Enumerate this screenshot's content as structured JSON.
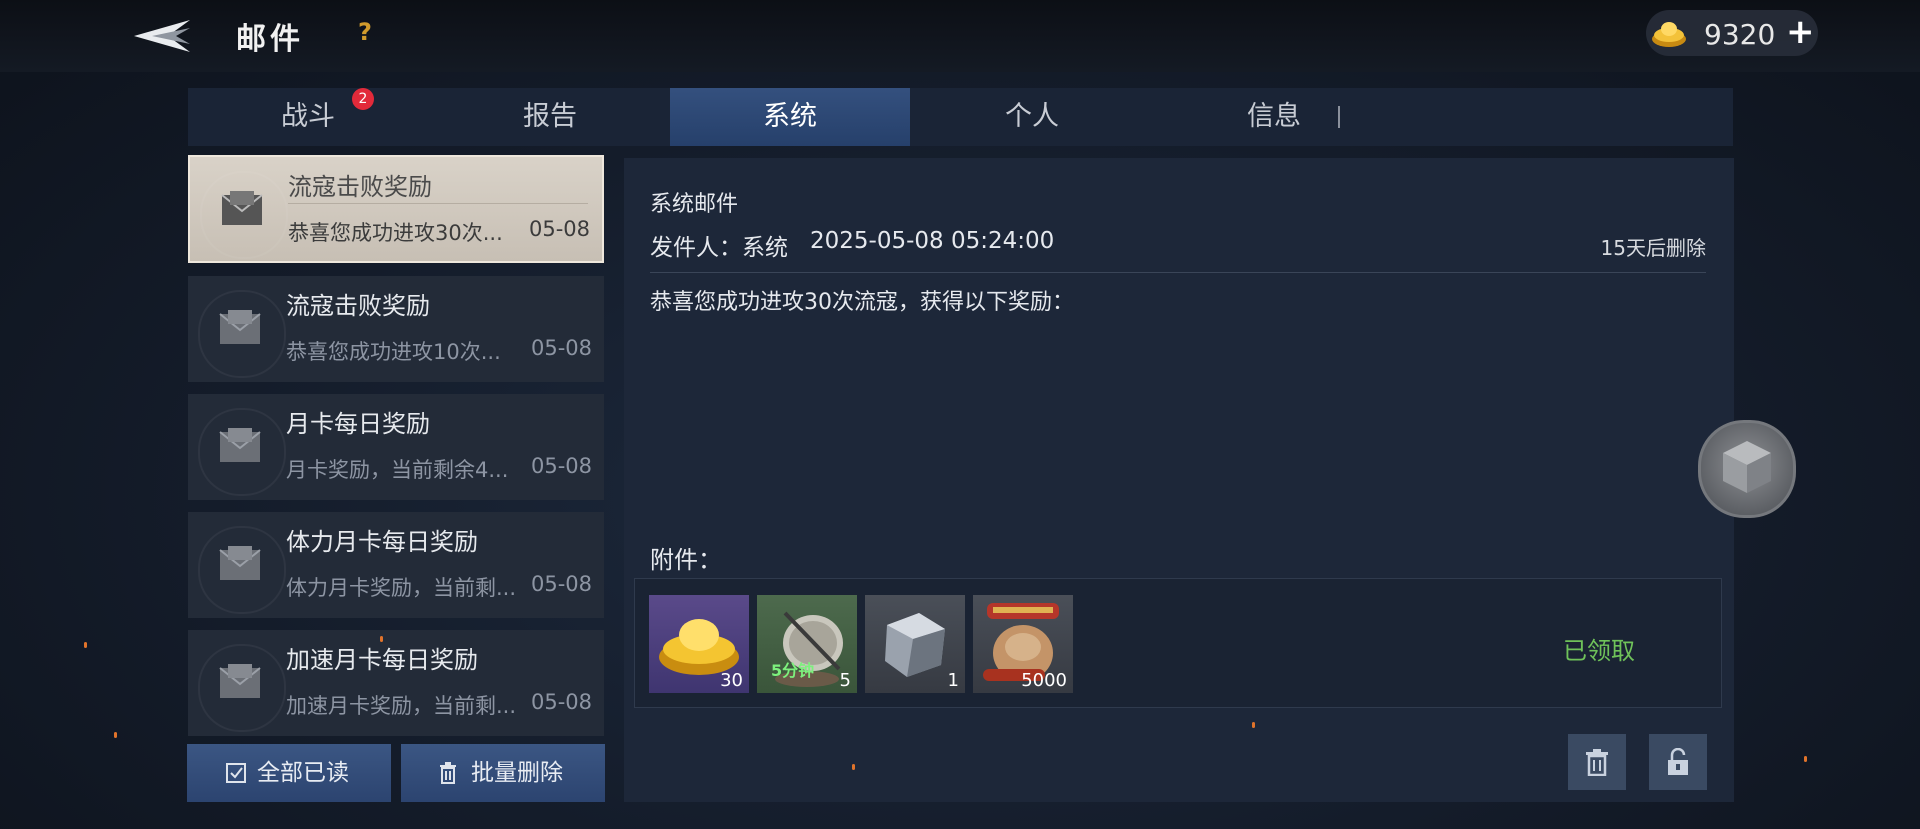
{
  "header": {
    "title": "邮件",
    "help": "?",
    "currency_amount": "9320",
    "plus": "+"
  },
  "tabs": [
    {
      "label": "战斗",
      "badge": "2"
    },
    {
      "label": "报告"
    },
    {
      "label": "系统",
      "active": true
    },
    {
      "label": "个人"
    },
    {
      "label": "信息"
    }
  ],
  "mails": [
    {
      "title": "流寇击败奖励",
      "preview": "恭喜您成功进攻30次...",
      "date": "05-08",
      "selected": true
    },
    {
      "title": "流寇击败奖励",
      "preview": "恭喜您成功进攻10次...",
      "date": "05-08"
    },
    {
      "title": "月卡每日奖励",
      "preview": "月卡奖励，当前剩余4...",
      "date": "05-08"
    },
    {
      "title": "体力月卡每日奖励",
      "preview": "体力月卡奖励，当前剩...",
      "date": "05-08"
    },
    {
      "title": "加速月卡每日奖励",
      "preview": "加速月卡奖励，当前剩...",
      "date": "05-08"
    }
  ],
  "actions": {
    "mark_all_read": "全部已读",
    "batch_delete": "批量删除"
  },
  "detail": {
    "title": "系统邮件",
    "sender": "发件人：系统",
    "datetime": "2025-05-08 05:24:00",
    "expire": "15天后删除",
    "body": "恭喜您成功进攻30次流寇，获得以下奖励：",
    "attachments_label": "附件：",
    "attachments": [
      {
        "icon": "gold-ingot-icon",
        "qty": "30"
      },
      {
        "icon": "speedup-5min-icon",
        "label": "5分钟",
        "qty": "5"
      },
      {
        "icon": "iron-ore-icon",
        "qty": "1"
      },
      {
        "icon": "resource-sack-icon",
        "qty": "5000"
      }
    ],
    "claimed_text": "已领取"
  },
  "colors": {
    "active_tab": "#2f4a78",
    "claimed": "#6fc25a",
    "badge": "#e22a3a",
    "help": "#d19b2c"
  }
}
